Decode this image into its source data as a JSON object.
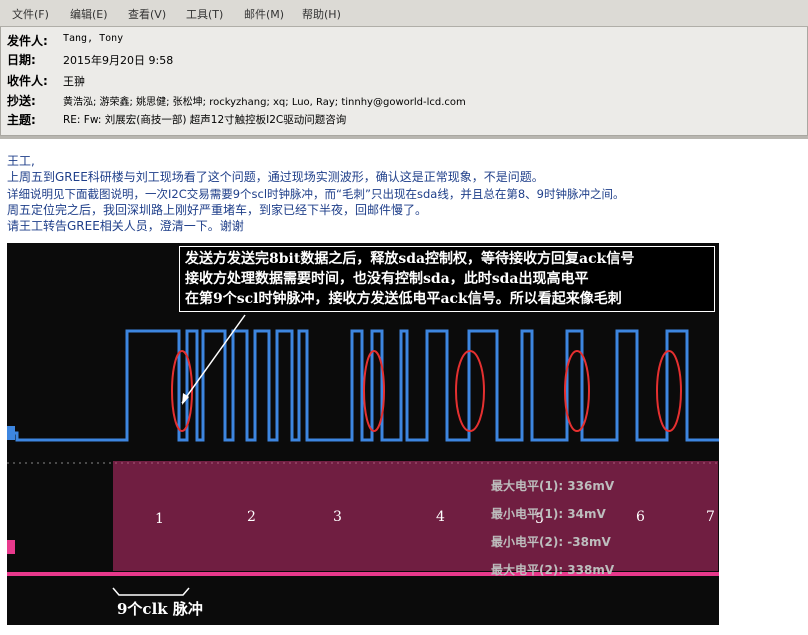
{
  "menu": [
    "文件(F)",
    "编辑(E)",
    "查看(V)",
    "工具(T)",
    "邮件(M)",
    "帮助(H)"
  ],
  "header": {
    "from_label": "发件人:",
    "from_value": "Tang, Tony",
    "date_label": "日期:",
    "date_value": "2015年9月20日 9:58",
    "to_label": "收件人:",
    "to_value": "王翀",
    "cc_label": "抄送:",
    "cc_value": "黄浩泓; 游荣鑫; 姚思健; 张松坤; rockyzhang; xq; Luo, Ray; tinnhy@goworld-lcd.com",
    "subject_label": "主题:",
    "subject_value": "RE: Fw: 刘展宏(商技一部) 超声12寸触控板I2C驱动问题咨询"
  },
  "body": [
    "王工,",
    "上周五到GREE科研楼与刘工现场看了这个问题，通过现场实测波形，确认这是正常现象，不是问题。",
    "详细说明见下面截图说明，一次I2C交易需要9个scl时钟脉冲，而“毛刺”只出现在sda线，并且总在第8、9时钟脉冲之间。",
    "周五定位完之后，我回深圳路上刚好严重堵车，到家已经下半夜，回邮件慢了。",
    "请王工转告GREE相关人员，澄清一下。谢谢"
  ],
  "scope": {
    "callout": [
      "发送方发送完8bit数据之后，释放sda控制权，等待接收方回复ack信号",
      "接收方处理数据需要时间，也没有控制sda，此时sda出现高电平",
      "在第9个scl时钟脉冲，接收方发送低电平ack信号。所以看起来像毛刺"
    ],
    "numbers": [
      "1",
      "2",
      "3",
      "4",
      "5",
      "6",
      "7"
    ],
    "measurements": [
      "最大电平(1): 336mV",
      "最小电平(1): 34mV",
      "最小电平(2): -38mV",
      "最大电平(2): 338mV"
    ],
    "clk_label": "9个clk 脉冲",
    "colors": {
      "sda": "#3d86e0",
      "scl": "#e8398c",
      "annotation": "#e53030"
    }
  }
}
